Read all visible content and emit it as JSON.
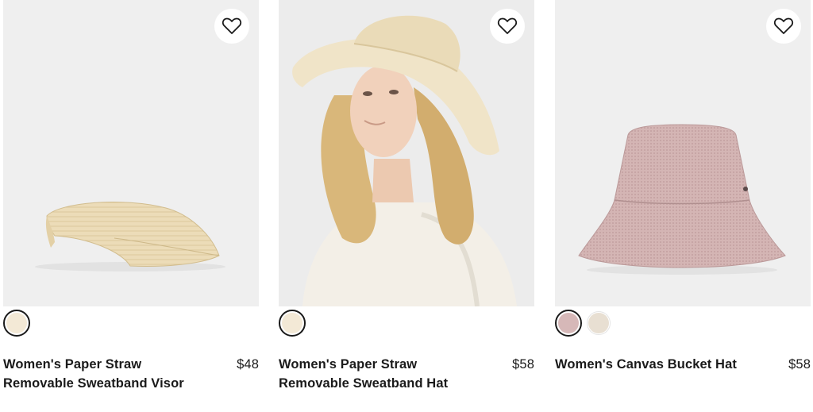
{
  "products": [
    {
      "name": "Women's Paper Straw Removable Sweatband Visor",
      "price": "$48",
      "swatches": [
        {
          "color": "#f3e9d6",
          "selected": true
        }
      ]
    },
    {
      "name": "Women's Paper Straw Removable Sweatband Hat",
      "price": "$58",
      "swatches": [
        {
          "color": "#f3e9d6",
          "selected": true
        }
      ]
    },
    {
      "name": "Women's Canvas Bucket Hat",
      "price": "$58",
      "swatches": [
        {
          "color": "#d6b8b8",
          "selected": true
        },
        {
          "color": "#e8dfd2",
          "selected": false
        }
      ]
    }
  ],
  "icons": {
    "favorite": "heart-outline-icon"
  },
  "colors": {
    "background": "#ffffff",
    "photo_bg": "#efefef",
    "text": "#1a1a1a"
  }
}
